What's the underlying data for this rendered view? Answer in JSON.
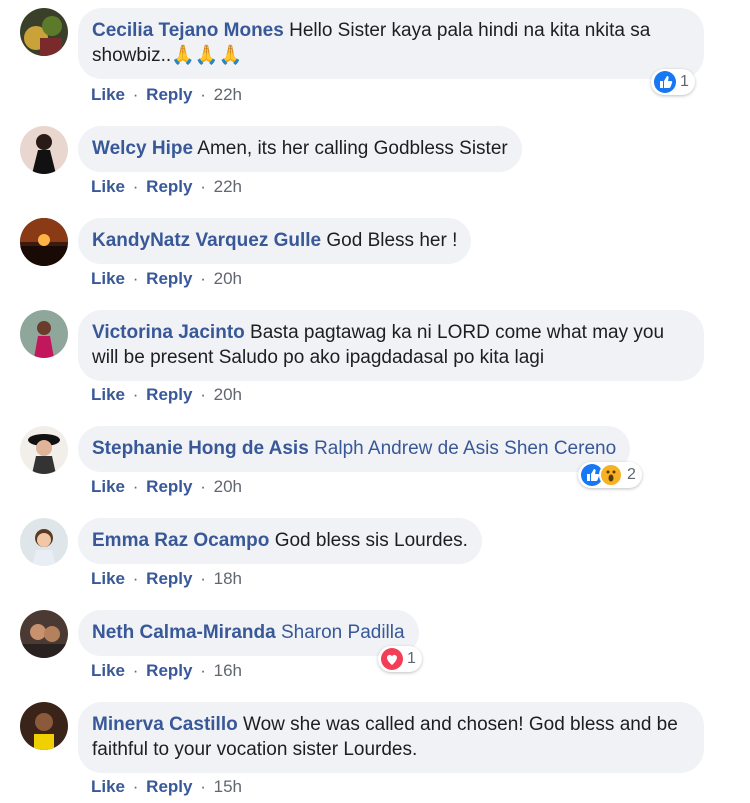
{
  "actions": {
    "like": "Like",
    "reply": "Reply",
    "sep": "·"
  },
  "comments": [
    {
      "author": "Cecilia Tejano Mones",
      "text": "Hello Sister kaya pala hindi na kita nkita sa showbiz..🙏🙏🙏",
      "time": "22h",
      "reactions": {
        "icons": [
          "like-icon"
        ],
        "count": "1"
      }
    },
    {
      "author": "Welcy Hipe",
      "text": "Amen, its her calling Godbless Sister",
      "time": "22h"
    },
    {
      "author": "KandyNatz Varquez Gulle",
      "text": "God Bless her !",
      "time": "20h"
    },
    {
      "author": "Victorina Jacinto",
      "text": "Basta pagtawag ka ni LORD come what may you will be present Saludo po ako ipagdadasal po kita lagi",
      "time": "20h"
    },
    {
      "author": "Stephanie Hong de Asis",
      "tagged": "Ralph Andrew de Asis Shen Cereno",
      "time": "20h",
      "reactions": {
        "icons": [
          "like-icon",
          "wow-icon"
        ],
        "count": "2"
      }
    },
    {
      "author": "Emma Raz Ocampo",
      "text": "God bless sis Lourdes.",
      "time": "18h"
    },
    {
      "author": "Neth Calma-Miranda",
      "tagged": "Sharon Padilla",
      "time": "16h",
      "reactions": {
        "icons": [
          "love-icon"
        ],
        "count": "1"
      }
    },
    {
      "author": "Minerva Castillo",
      "text": "Wow she was called and chosen! God bless and be faithful to your vocation sister Lourdes.",
      "time": "15h"
    }
  ],
  "colors": {
    "link": "#385898",
    "bubble": "#f0f2f5",
    "like": "#1877f2",
    "love": "#f33e58",
    "wow": "#f7b125"
  }
}
